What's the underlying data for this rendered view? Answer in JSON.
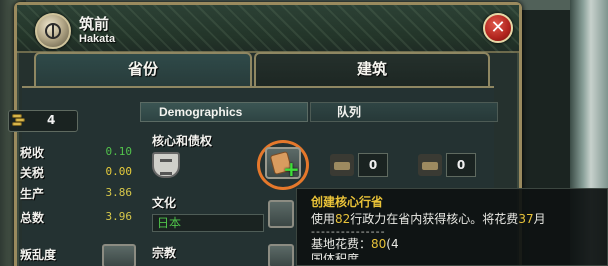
{
  "window": {
    "title": "筑前",
    "subtitle": "Hakata",
    "close_symbol": "✕"
  },
  "tabs": [
    {
      "label": "省份",
      "active": true
    },
    {
      "label": "建筑",
      "active": false
    }
  ],
  "province": {
    "dev_badge_value": "4",
    "stats": [
      {
        "label": "税收",
        "value": "0.10",
        "color": "#52c24c"
      },
      {
        "label": "关税",
        "value": "0.00",
        "color": "#e6cc3c"
      },
      {
        "label": "生产",
        "value": "3.86",
        "color": "#d7c84a"
      },
      {
        "label": "总数",
        "value": "3.96",
        "color": "#d7c84a"
      }
    ],
    "unrest_label": "叛乱度"
  },
  "demographics": {
    "header": "Demographics",
    "queue_header": "队列",
    "core_label": "核心和债权",
    "culture_label": "文化",
    "culture_value": "日本",
    "religion_label": "宗教",
    "queue_counts": [
      "0",
      "0"
    ]
  },
  "tooltip": {
    "title": "创建核心行省",
    "desc_prefix": "使用",
    "desc_value": "82",
    "desc_mid": "行政力在省内获得核心。将花费",
    "desc_months": "37",
    "desc_suffix": "月",
    "separator": "---------------",
    "cost_label": "基地花费：",
    "cost_value": "80",
    "cost_suffix": "(4",
    "cut_line": "国体积度"
  },
  "colors": {
    "accent_gold": "#eac338",
    "positive_green": "#52c24c",
    "highlight_orange": "#e5782b"
  }
}
